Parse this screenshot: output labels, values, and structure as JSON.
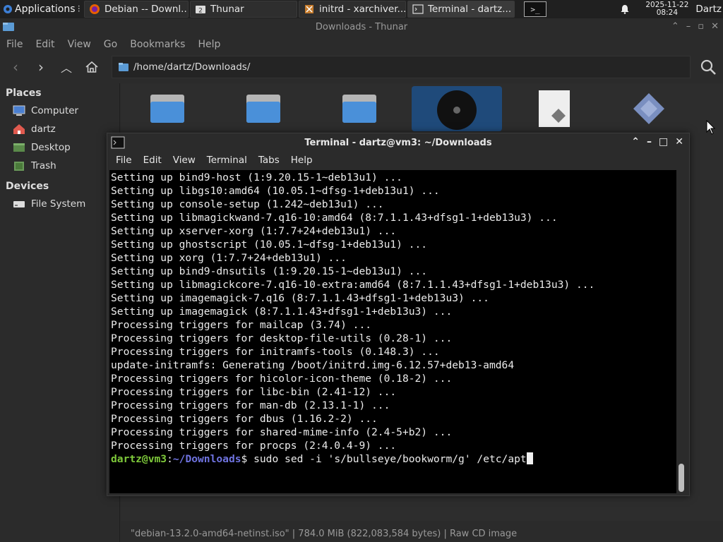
{
  "panel": {
    "applications_label": "Applications",
    "tasks": [
      {
        "label": "Debian -- Downl...",
        "icon": "firefox-icon"
      },
      {
        "label": "Thunar",
        "icon": "folder-icon"
      },
      {
        "label": "initrd - xarchiver...",
        "icon": "archive-icon"
      },
      {
        "label": "Terminal - dartz...",
        "icon": "terminal-icon"
      }
    ],
    "clock_date": "2025-11-22",
    "clock_time": "08:24",
    "user": "Dartz"
  },
  "thunar": {
    "title": "Downloads - Thunar",
    "menu": [
      "File",
      "Edit",
      "View",
      "Go",
      "Bookmarks",
      "Help"
    ],
    "path": "/home/dartz/Downloads/",
    "sidebar": {
      "places_header": "Places",
      "places": [
        "Computer",
        "dartz",
        "Desktop",
        "Trash"
      ],
      "devices_header": "Devices",
      "devices": [
        "File System"
      ]
    },
    "status": "\"debian-13.2.0-amd64-netinst.iso\"  |  784.0 MiB (822,083,584 bytes)  |  Raw CD image"
  },
  "terminal": {
    "title": "Terminal - dartz@vm3: ~/Downloads",
    "menu": [
      "File",
      "Edit",
      "View",
      "Terminal",
      "Tabs",
      "Help"
    ],
    "lines": [
      "Setting up bind9-host (1:9.20.15-1~deb13u1) ...",
      "Setting up libgs10:amd64 (10.05.1~dfsg-1+deb13u1) ...",
      "Setting up console-setup (1.242~deb13u1) ...",
      "Setting up libmagickwand-7.q16-10:amd64 (8:7.1.1.43+dfsg1-1+deb13u3) ...",
      "Setting up xserver-xorg (1:7.7+24+deb13u1) ...",
      "Setting up ghostscript (10.05.1~dfsg-1+deb13u1) ...",
      "Setting up xorg (1:7.7+24+deb13u1) ...",
      "Setting up bind9-dnsutils (1:9.20.15-1~deb13u1) ...",
      "Setting up libmagickcore-7.q16-10-extra:amd64 (8:7.1.1.43+dfsg1-1+deb13u3) ...",
      "Setting up imagemagick-7.q16 (8:7.1.1.43+dfsg1-1+deb13u3) ...",
      "Setting up imagemagick (8:7.1.1.43+dfsg1-1+deb13u3) ...",
      "Processing triggers for mailcap (3.74) ...",
      "Processing triggers for desktop-file-utils (0.28-1) ...",
      "Processing triggers for initramfs-tools (0.148.3) ...",
      "update-initramfs: Generating /boot/initrd.img-6.12.57+deb13-amd64",
      "Processing triggers for hicolor-icon-theme (0.18-2) ...",
      "Processing triggers for libc-bin (2.41-12) ...",
      "Processing triggers for man-db (2.13.1-1) ...",
      "Processing triggers for dbus (1.16.2-2) ...",
      "Processing triggers for shared-mime-info (2.4-5+b2) ...",
      "Processing triggers for procps (2:4.0.4-9) ..."
    ],
    "prompt_user": "dartz@vm3",
    "prompt_sep": ":",
    "prompt_path": "~/Downloads",
    "prompt_dollar": "$ ",
    "command": "sudo sed -i 's/bullseye/bookworm/g' /etc/apt"
  }
}
